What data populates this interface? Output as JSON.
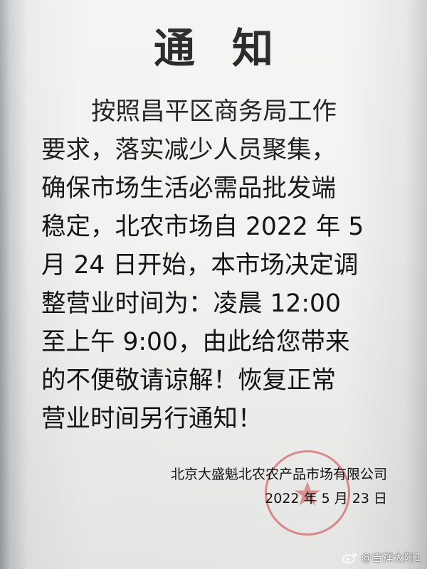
{
  "notice": {
    "title": "通知",
    "body_lines": [
      "按照昌平区商务局工作",
      "要求，落实减少人员聚集，",
      "确保市场生活必需品批发端",
      "稳定，北农市场自 2022 年 5",
      "月 24 日开始，本市场决定调",
      "整营业时间为：凌晨 12:00",
      "至上午 9:00，由此给您带来",
      "的不便敬请谅解！恢复正常",
      "营业时间另行通知！"
    ],
    "company": "北京大盛魁北农农产品市场有限公司",
    "date": "2022 年 5 月 23 日"
  },
  "watermark": {
    "icon": "weibo-icon",
    "text": "@吉祥太阳1"
  },
  "colors": {
    "seal": "#d63a3a",
    "text": "#141414",
    "paper": "#f2f2f2"
  }
}
